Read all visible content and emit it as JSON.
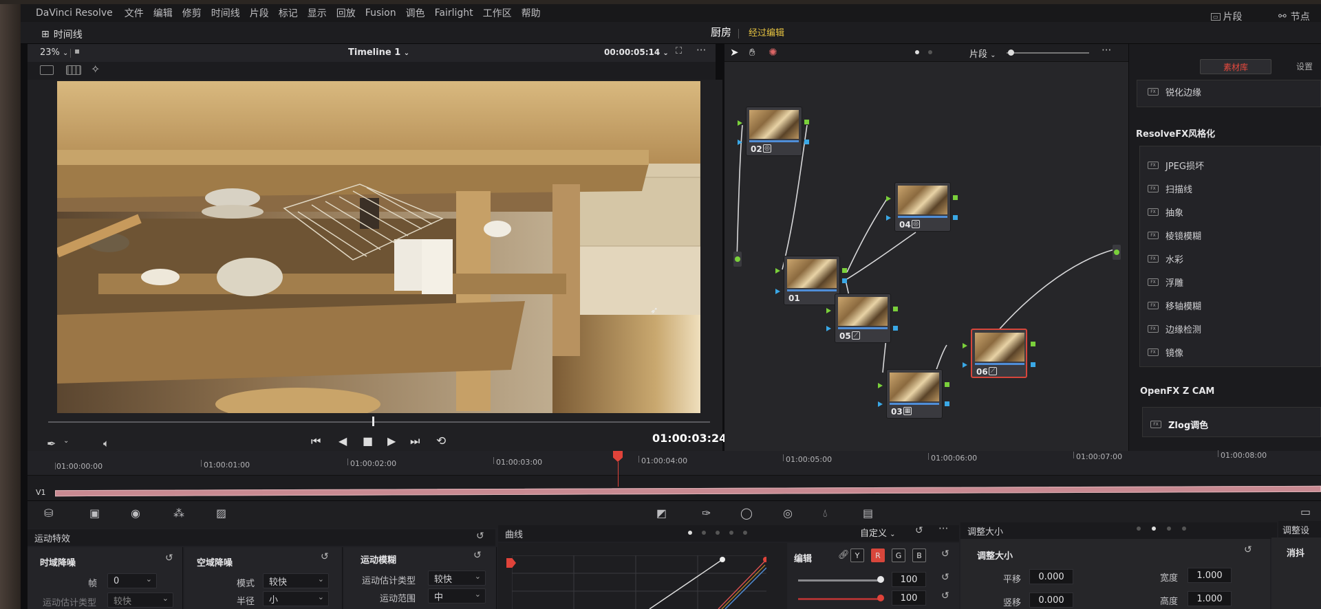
{
  "app": {
    "name": "DaVinci Resolve"
  },
  "menu": [
    "文件",
    "编辑",
    "修剪",
    "时间线",
    "片段",
    "标记",
    "显示",
    "回放",
    "Fusion",
    "调色",
    "Fairlight",
    "工作区",
    "帮助"
  ],
  "menu_right": {
    "clips": "片段",
    "lightbox": "节点"
  },
  "toolbar": {
    "timeline_label": "时间线",
    "kitchen": "厨房",
    "edited": "经过编辑"
  },
  "viewer": {
    "zoom": "23%",
    "timeline_name": "Timeline 1",
    "source_tc": "00:00:05:14",
    "current_tc": "01:00:03:24",
    "playhead_fraction": 0.49
  },
  "node_editor": {
    "mode": "片段",
    "nodes": [
      {
        "id": "02",
        "icon": "circle"
      },
      {
        "id": "04",
        "icon": "circle"
      },
      {
        "id": "01",
        "icon": ""
      },
      {
        "id": "05",
        "icon": "slash"
      },
      {
        "id": "03",
        "icon": "grid"
      },
      {
        "id": "06",
        "icon": "slash",
        "selected": true
      }
    ]
  },
  "library": {
    "tabs": {
      "library": "素材库",
      "settings": "设置"
    },
    "top_item": "锐化边缘",
    "section_stylize": "ResolveFX风格化",
    "stylize_items": [
      "JPEG损坏",
      "扫描线",
      "抽象",
      "棱镜模糊",
      "水彩",
      "浮雕",
      "移轴模糊",
      "边缘检测",
      "镜像"
    ],
    "section_zcam": "OpenFX Z CAM",
    "zcam_item": "Zlog调色"
  },
  "timeline": {
    "ticks": [
      "01:00:00:00",
      "01:00:01:00",
      "01:00:02:00",
      "01:00:03:00",
      "01:00:04:00",
      "01:00:05:00",
      "01:00:06:00",
      "01:00:07:00",
      "01:00:08:00"
    ],
    "track": "V1"
  },
  "motion_panel": {
    "title": "运动特效",
    "temporal": {
      "title": "时域降噪",
      "frames_label": "帧",
      "frames_value": "0",
      "motion_est_label": "运动估计类型",
      "motion_est_value": "较快"
    },
    "spatial": {
      "title": "空域降噪",
      "mode_label": "模式",
      "mode_value": "较快",
      "radius_label": "半径",
      "radius_value": "小"
    },
    "blur": {
      "title": "运动模糊",
      "est_label": "运动估计类型",
      "est_value": "较快",
      "range_label": "运动范围",
      "range_value": "中"
    }
  },
  "curves": {
    "title": "曲线",
    "preset": "自定义",
    "edit_label": "编辑",
    "channels": [
      "Y",
      "R",
      "G",
      "B"
    ],
    "val1": "100",
    "val2": "100"
  },
  "resize": {
    "title": "调整大小",
    "subtitle": "调整大小",
    "pan_label": "平移",
    "pan_value": "0.000",
    "tilt_label": "竖移",
    "tilt_value": "0.000",
    "width_label": "宽度",
    "width_value": "1.000",
    "height_label": "高度",
    "height_value": "1.000",
    "right_title": "调整设",
    "dehaze": "消抖"
  }
}
